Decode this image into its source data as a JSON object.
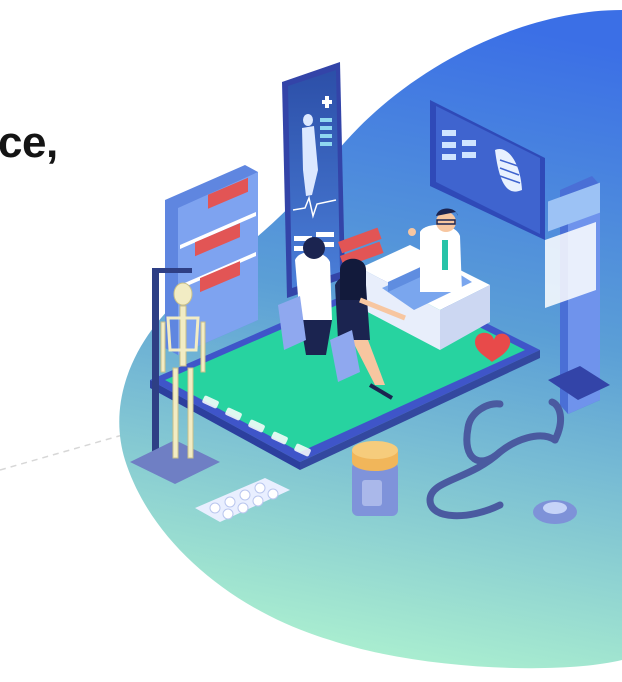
{
  "headline": {
    "fragment": "ce,"
  },
  "illustration": {
    "subject": "medical-consultation-illustration",
    "colors": {
      "blob_top": "#3b6fe6",
      "blob_mid": "#5a9bd8",
      "blob_bottom": "#a8f0cf",
      "tablet_screen": "#27d3a0",
      "tablet_frame": "#3f55c9",
      "accent_red": "#e84a4a",
      "doctor_coat": "#ffffff"
    },
    "elements": [
      "phone-body-scan-screen",
      "xray-monitor",
      "bookshelf",
      "skeleton-model",
      "doctor",
      "patient",
      "companion",
      "desk",
      "laptop",
      "heart-cushion",
      "xray-machine",
      "stethoscope",
      "pill-blister",
      "medicine-jar"
    ]
  }
}
